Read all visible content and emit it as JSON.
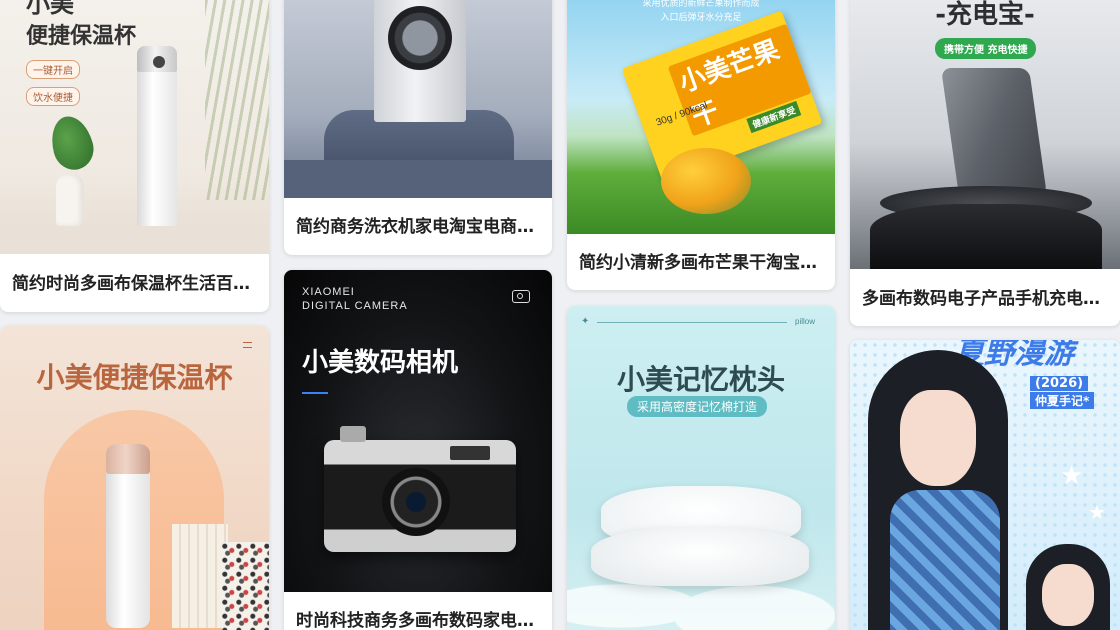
{
  "cards": [
    {
      "id": "thermos-1",
      "caption": "简约时尚多画布保温杯生活百…",
      "poster": {
        "title_top": "小美",
        "title": "便捷保温杯",
        "tags": [
          "一键开启",
          "饮水便捷"
        ]
      }
    },
    {
      "id": "washer",
      "caption": "简约商务洗衣机家电淘宝电商…",
      "poster": {}
    },
    {
      "id": "mango",
      "caption": "简约小清新多画布芒果干淘宝…",
      "poster": {
        "lines": [
          "采用优质的新鲜芒果制作而成",
          "入口后弹牙水分充足"
        ],
        "pack_title": "小美芒果干",
        "pack_weight": "30g / 90kcal",
        "pack_tag": "健康新享受"
      }
    },
    {
      "id": "powerbank",
      "caption": "多画布数码电子产品手机充电…",
      "poster": {
        "title": "-充电宝-",
        "badge": "携带方便 充电快捷"
      }
    },
    {
      "id": "thermos-2",
      "caption": "",
      "poster": {
        "title": "小美便捷保温杯"
      }
    },
    {
      "id": "camera",
      "caption": "时尚科技商务多画布数码家电…",
      "poster": {
        "brand_line1": "XIAOMEI",
        "brand_line2": "DIGITAL CAMERA",
        "title": "小美数码相机"
      }
    },
    {
      "id": "pillow",
      "caption": "",
      "poster": {
        "corner": "pillow",
        "title": "小美记忆枕头",
        "subtitle": "采用高密度记忆棉打造"
      }
    },
    {
      "id": "summer",
      "caption": "",
      "poster": {
        "title": "夏野漫游",
        "year": "(2026)",
        "sub": "仲夏手记*"
      }
    }
  ]
}
